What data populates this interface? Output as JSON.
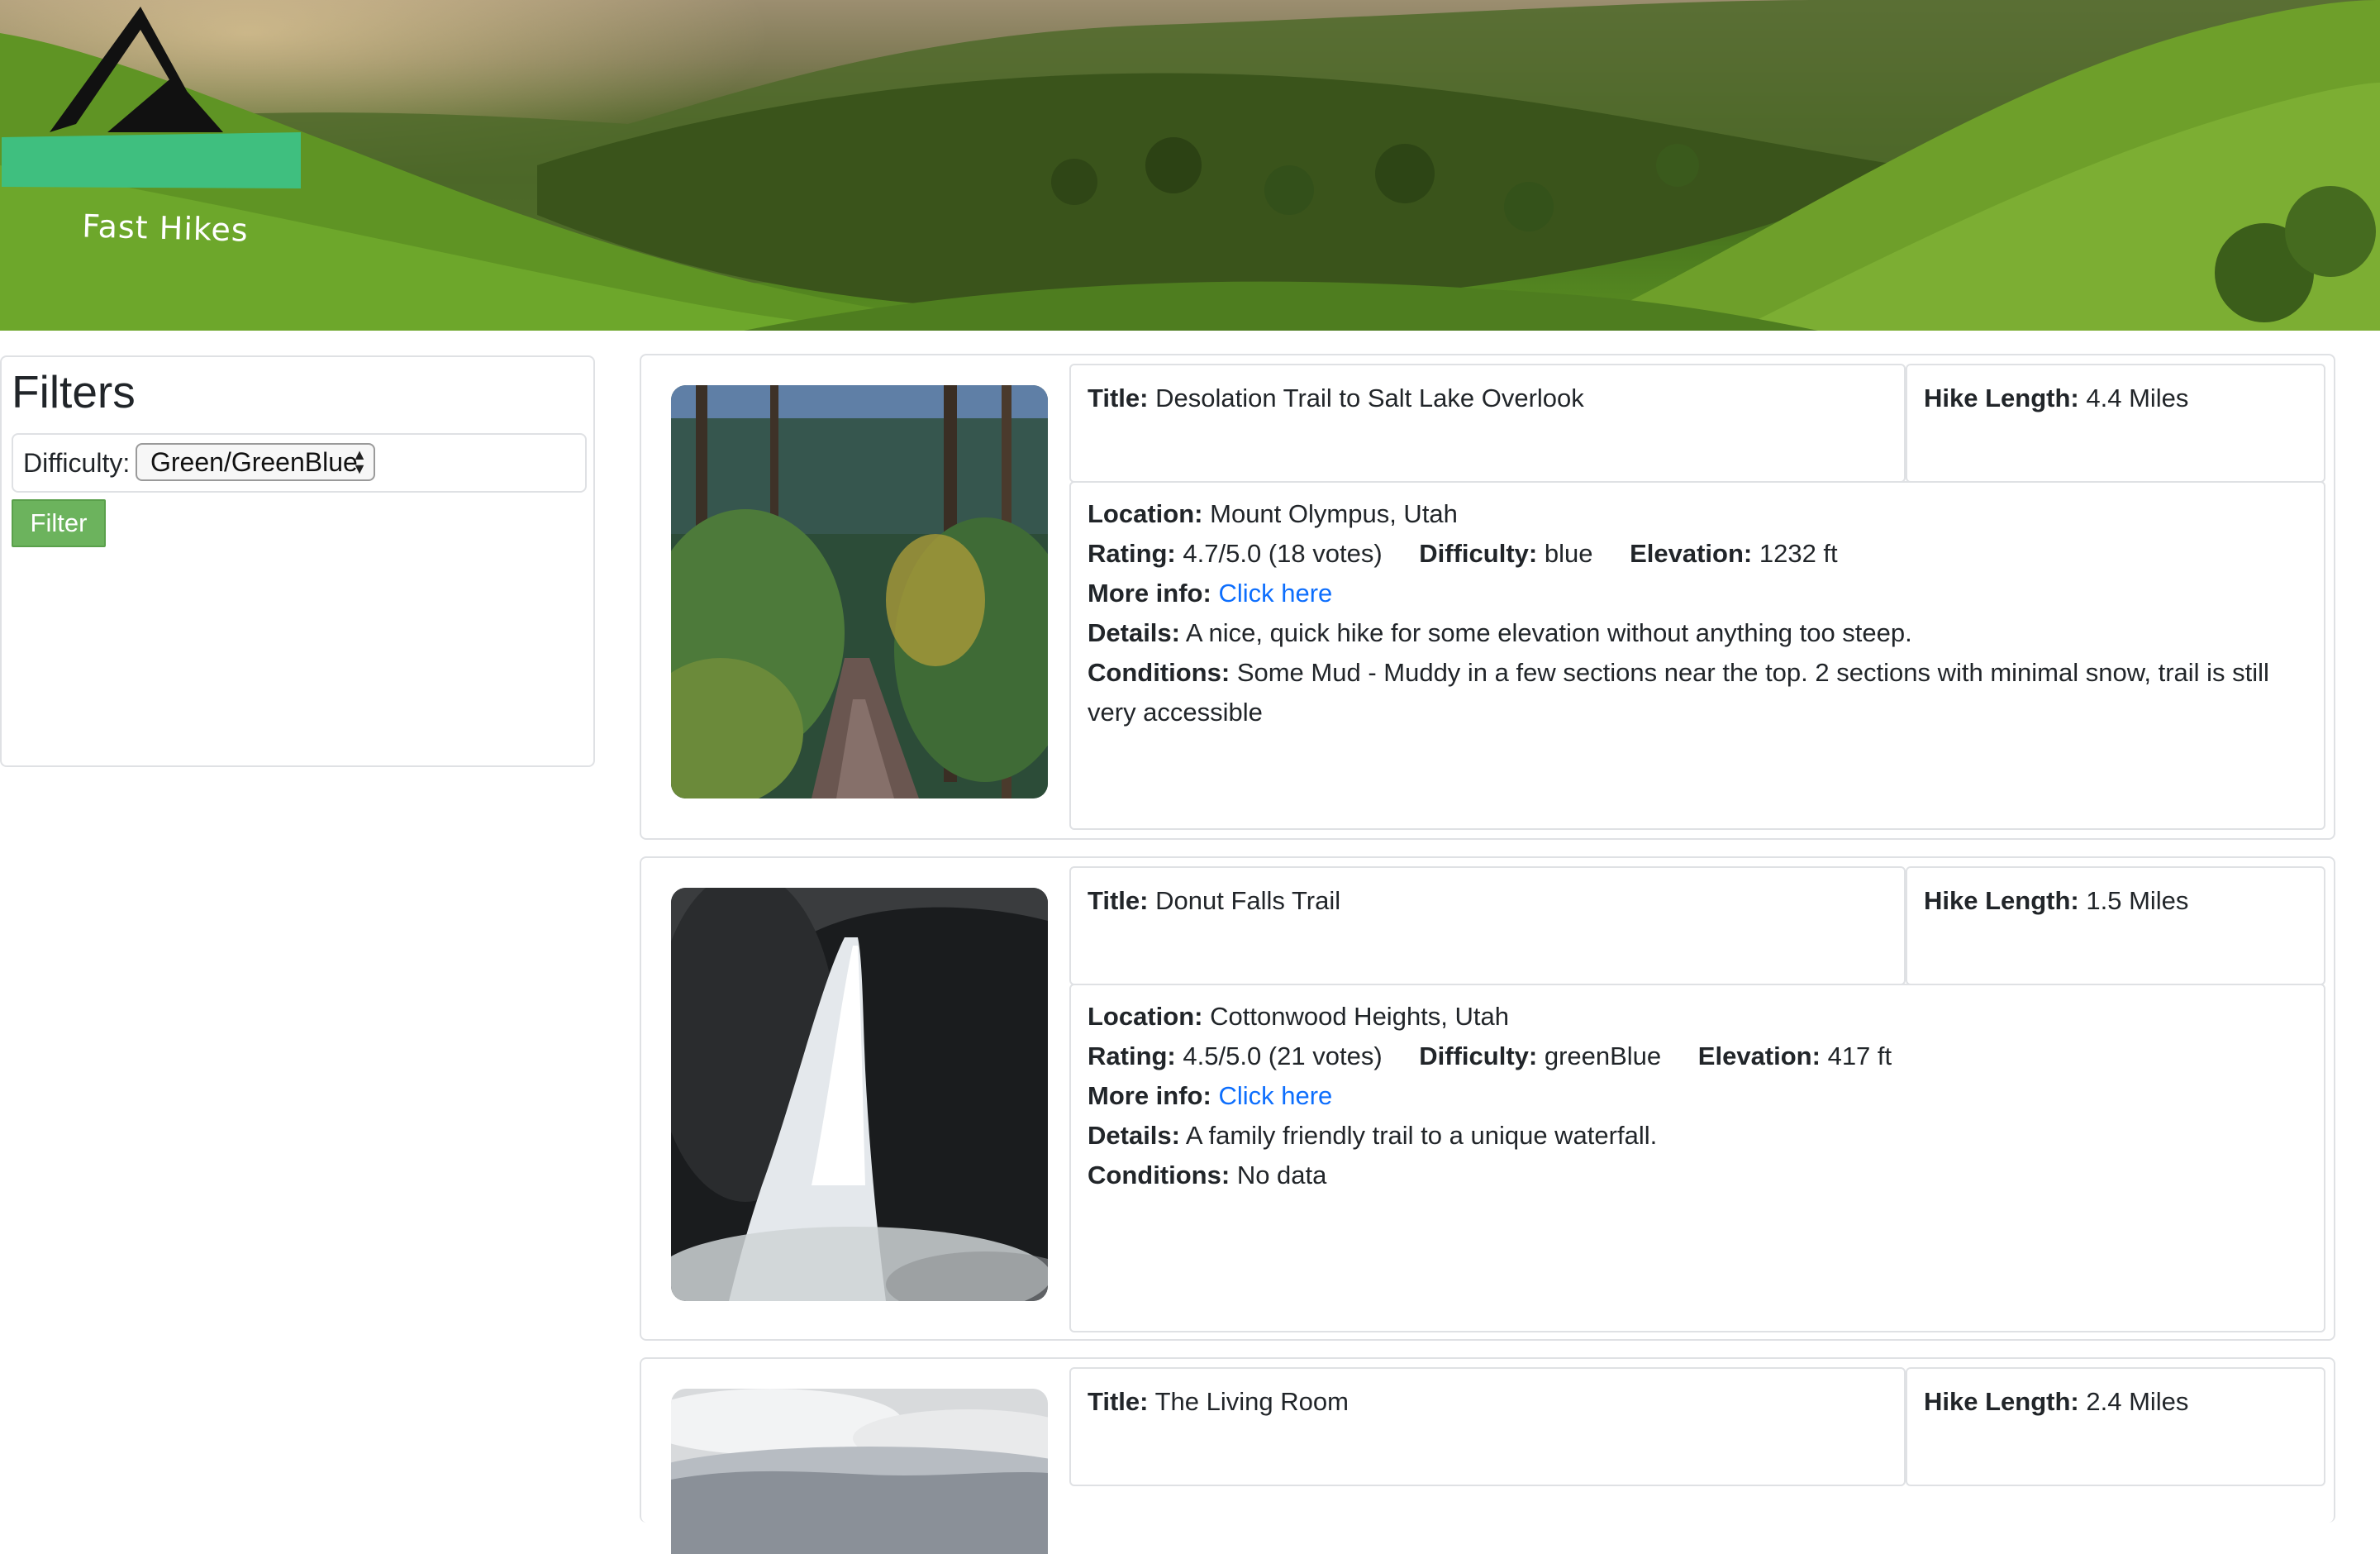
{
  "header": {
    "logo_text": "Fast Hikes"
  },
  "filters": {
    "title": "Filters",
    "difficulty_label": "Difficulty:",
    "difficulty_value": "Green/GreenBlue",
    "filter_button": "Filter"
  },
  "labels": {
    "title": "Title:",
    "hike_length": "Hike Length:",
    "location": "Location:",
    "rating": "Rating:",
    "difficulty": "Difficulty:",
    "elevation": "Elevation:",
    "more_info": "More info:",
    "details": "Details:",
    "conditions": "Conditions:",
    "link_text": "Click here"
  },
  "hikes": [
    {
      "title": "Desolation Trail to Salt Lake Overlook",
      "length": "4.4 Miles",
      "location": "Mount Olympus, Utah",
      "rating": "4.7/5.0 (18 votes)",
      "difficulty": "blue",
      "elevation": "1232 ft",
      "details": "A nice, quick hike for some elevation without anything too steep.",
      "conditions": "Some Mud - Muddy in a few sections near the top. 2 sections with minimal snow, trail is still very accessible"
    },
    {
      "title": "Donut Falls Trail",
      "length": "1.5 Miles",
      "location": "Cottonwood Heights, Utah",
      "rating": "4.5/5.0 (21 votes)",
      "difficulty": "greenBlue",
      "elevation": "417 ft",
      "details": "A family friendly trail to a unique waterfall.",
      "conditions": "No data"
    },
    {
      "title": "The Living Room",
      "length": "2.4 Miles"
    }
  ],
  "colors": {
    "link": "#0d6efd",
    "filter_button": "#6cb35d",
    "logo_banner": "#3fbf7f",
    "border": "#dfe1e4"
  }
}
